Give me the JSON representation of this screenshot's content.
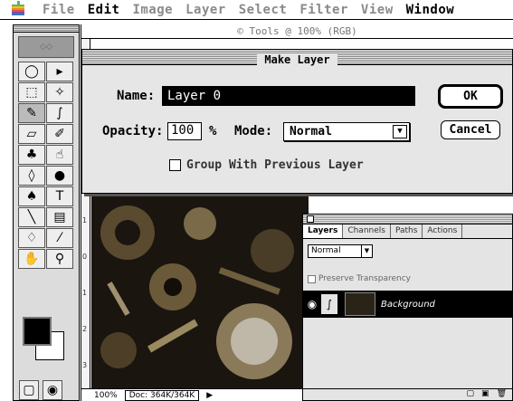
{
  "menubar": {
    "apple_icon": "apple-logo-icon",
    "items": [
      {
        "label": "File",
        "active": false
      },
      {
        "label": "Edit",
        "active": true
      },
      {
        "label": "Image",
        "active": false
      },
      {
        "label": "Layer",
        "active": false
      },
      {
        "label": "Select",
        "active": false
      },
      {
        "label": "Filter",
        "active": false
      },
      {
        "label": "View",
        "active": false
      },
      {
        "label": "Window",
        "active": true
      }
    ]
  },
  "document": {
    "title": "© Tools @ 100% (RGB)",
    "ruler_marks": [
      "1",
      "0",
      "1",
      "2",
      "3"
    ],
    "status": {
      "zoom": "100%",
      "doc": "Doc: 364K/364K"
    }
  },
  "toolbox": {
    "tools": [
      {
        "icon": "lasso-icon"
      },
      {
        "icon": "move-icon"
      },
      {
        "icon": "marquee-icon"
      },
      {
        "icon": "magic-wand-icon"
      },
      {
        "icon": "airbrush-icon"
      },
      {
        "icon": "paintbrush-icon"
      },
      {
        "icon": "eraser-icon"
      },
      {
        "icon": "pencil-icon"
      },
      {
        "icon": "stamp-icon"
      },
      {
        "icon": "smudge-icon"
      },
      {
        "icon": "blur-icon"
      },
      {
        "icon": "burn-icon"
      },
      {
        "icon": "pen-icon"
      },
      {
        "icon": "type-icon"
      },
      {
        "icon": "line-icon"
      },
      {
        "icon": "gradient-icon"
      },
      {
        "icon": "paint-bucket-icon"
      },
      {
        "icon": "eyedropper-icon"
      },
      {
        "icon": "hand-icon"
      },
      {
        "icon": "zoom-icon"
      }
    ]
  },
  "dialog": {
    "title": "Make Layer",
    "name_label": "Name:",
    "name_value": "Layer 0",
    "opacity_label": "Opacity:",
    "opacity_value": "100",
    "opacity_unit": "%",
    "mode_label": "Mode:",
    "mode_value": "Normal",
    "group_label": "Group With Previous Layer",
    "ok_label": "OK",
    "cancel_label": "Cancel"
  },
  "layers_palette": {
    "tabs": [
      "Layers",
      "Channels",
      "Paths",
      "Actions"
    ],
    "blend_mode": "Normal",
    "preserve_label": "Preserve Transparency",
    "layer_name": "Background"
  }
}
